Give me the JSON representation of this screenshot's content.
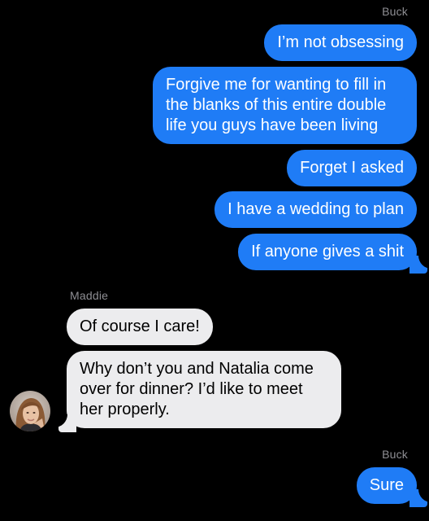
{
  "thread": {
    "messages": [
      {
        "sender": "Buck",
        "text": "I’m not obsessing"
      },
      {
        "sender": "Buck",
        "text": "Forgive me for wanting to fill in the blanks of this entire double life you guys have been living"
      },
      {
        "sender": "Buck",
        "text": "Forget I asked"
      },
      {
        "sender": "Buck",
        "text": "I have a wedding to plan"
      },
      {
        "sender": "Buck",
        "text": "If anyone gives a shit"
      },
      {
        "sender": "Maddie",
        "text": "Of course I care!"
      },
      {
        "sender": "Maddie",
        "text": "Why don’t you and Natalia come over for dinner? I’d like to meet her properly."
      },
      {
        "sender": "Buck",
        "text": "Sure"
      }
    ],
    "sender_labels": {
      "buck_top": "Buck",
      "maddie": "Maddie",
      "buck_bottom": "Buck"
    }
  },
  "colors": {
    "background": "#000000",
    "outgoing_bubble": "#1f7cf6",
    "incoming_bubble": "#ececee",
    "sender_label": "#8e8e93"
  },
  "icons": {
    "contact_avatar": "maddie-avatar"
  }
}
